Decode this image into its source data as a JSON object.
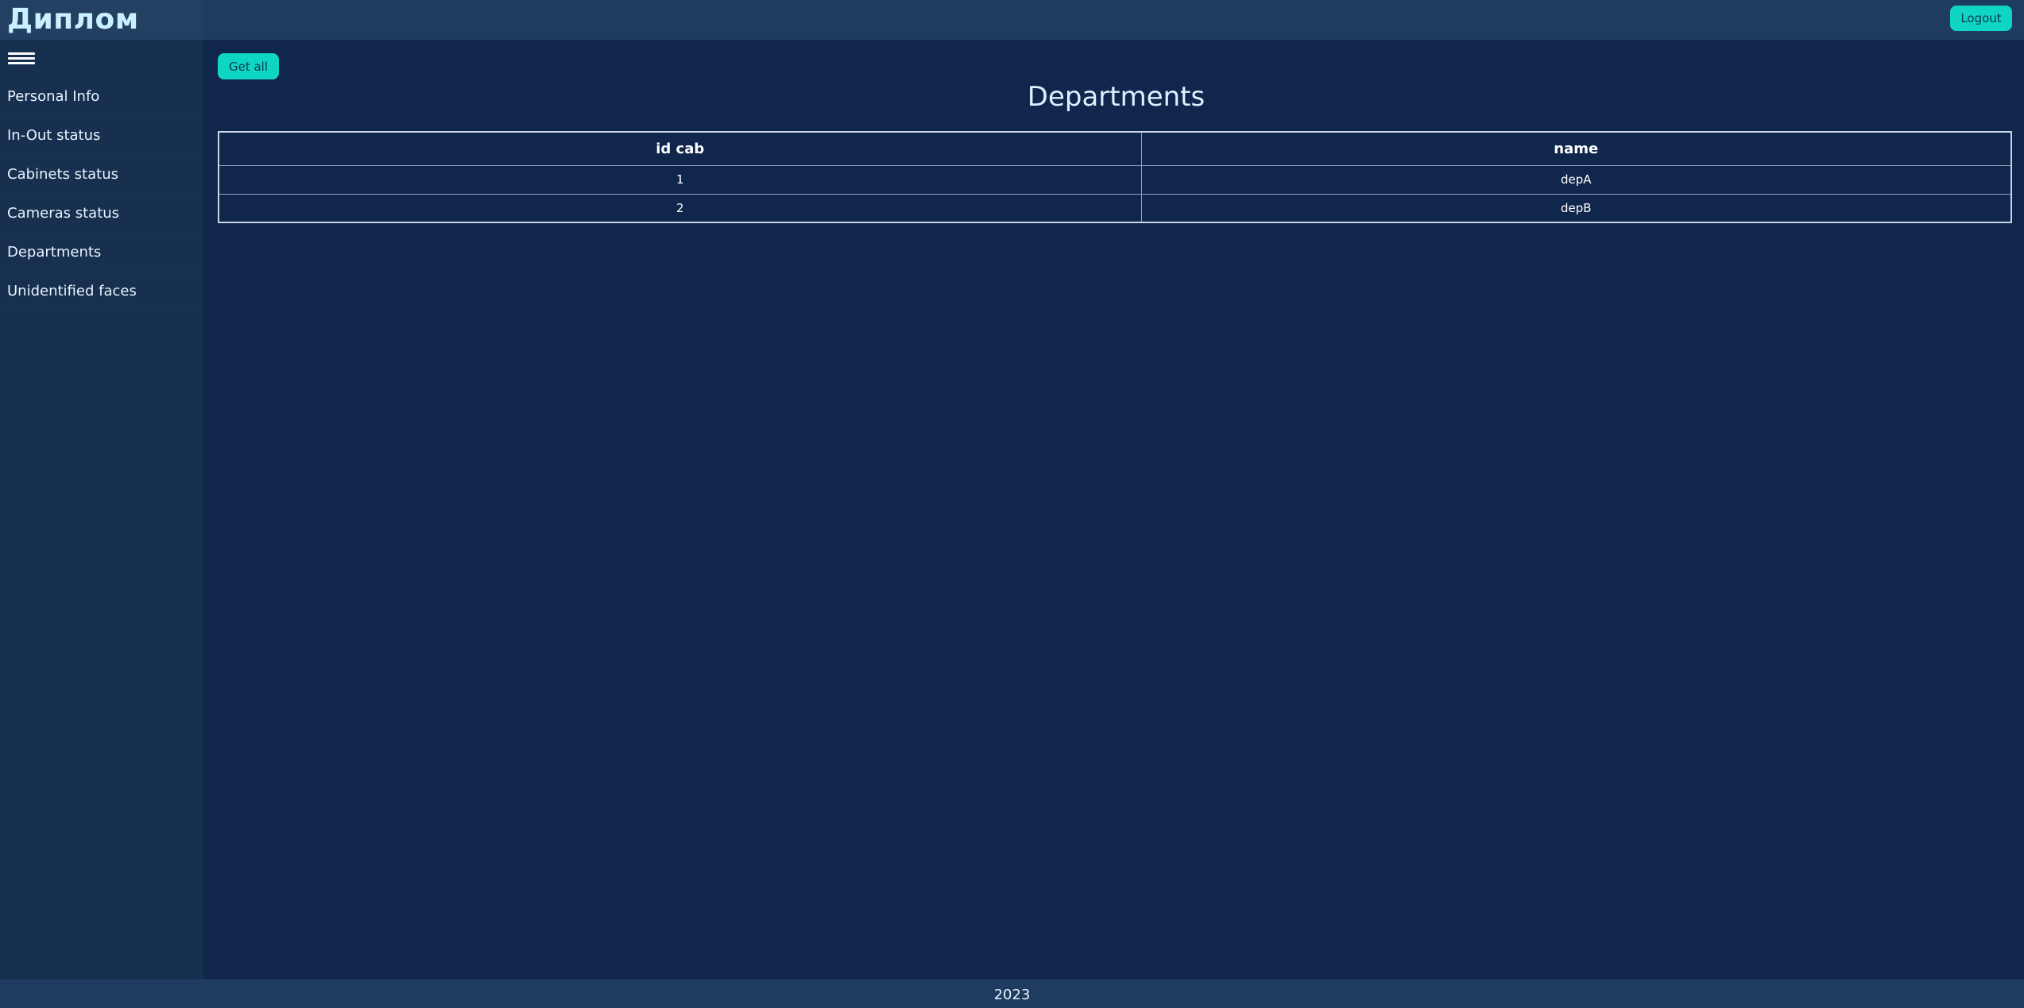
{
  "header": {
    "brand": "Диплом",
    "logout_label": "Logout"
  },
  "sidebar": {
    "items": [
      {
        "label": "Personal Info"
      },
      {
        "label": "In-Out status"
      },
      {
        "label": "Cabinets status"
      },
      {
        "label": "Cameras status"
      },
      {
        "label": "Departments"
      },
      {
        "label": "Unidentified faces"
      }
    ]
  },
  "main": {
    "get_all_label": "Get all",
    "title": "Departments",
    "table": {
      "columns": [
        "id cab",
        "name"
      ],
      "rows": [
        [
          "1",
          "depA"
        ],
        [
          "2",
          "depB"
        ]
      ]
    }
  },
  "footer": {
    "text": "2023"
  },
  "colors": {
    "background": "#10264c",
    "accent": "#0fd6c2",
    "header": "#1e3c5f",
    "sidebar": "#17304f"
  },
  "icons": {
    "menu": "hamburger-menu-icon"
  }
}
